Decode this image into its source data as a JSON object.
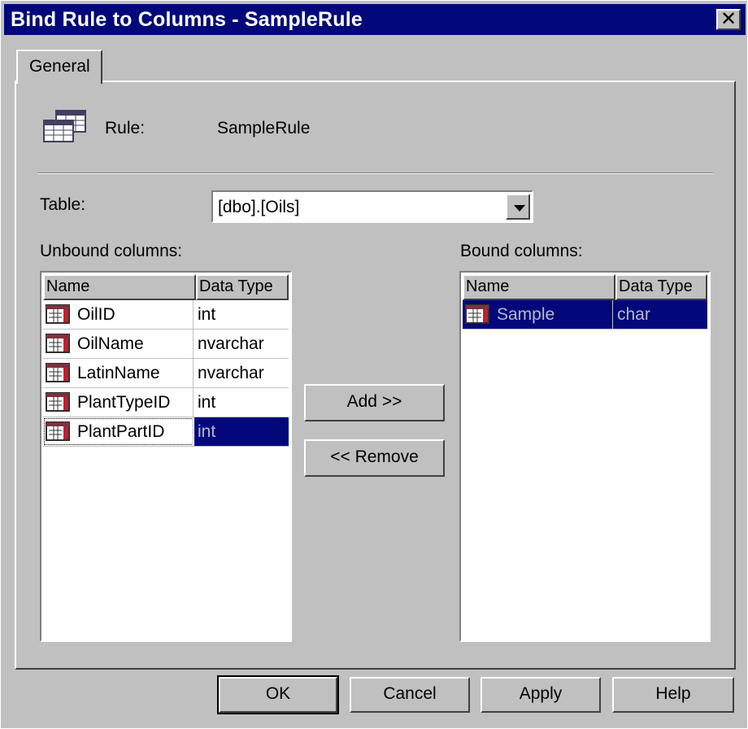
{
  "window": {
    "title": "Bind Rule to Columns - SampleRule",
    "close_label": "✕"
  },
  "tabs": [
    {
      "label": "General"
    }
  ],
  "rule": {
    "label": "Rule:",
    "value": "SampleRule"
  },
  "table": {
    "label": "Table:",
    "value": "[dbo].[Oils]"
  },
  "unbound": {
    "label": "Unbound columns:",
    "headers": [
      "Name",
      "Data Type"
    ],
    "rows": [
      {
        "name": "OilID",
        "type": "int",
        "selected": false
      },
      {
        "name": "OilName",
        "type": "nvarchar",
        "selected": false
      },
      {
        "name": "LatinName",
        "type": "nvarchar",
        "selected": false
      },
      {
        "name": "PlantTypeID",
        "type": "int",
        "selected": false
      },
      {
        "name": "PlantPartID",
        "type": "int",
        "selected": true
      }
    ]
  },
  "bound": {
    "label": "Bound columns:",
    "headers": [
      "Name",
      "Data Type"
    ],
    "rows": [
      {
        "name": "Sample",
        "type": "char",
        "selected": true
      }
    ]
  },
  "buttons": {
    "add": "Add >>",
    "remove": "<< Remove",
    "ok": "OK",
    "cancel": "Cancel",
    "apply": "Apply",
    "help": "Help"
  },
  "colors": {
    "title_bar": "#02087a",
    "selection": "#02087a",
    "face": "#c0c0c0"
  },
  "icons": {
    "rule": "table-rule-icon",
    "row": "table-column-icon"
  }
}
